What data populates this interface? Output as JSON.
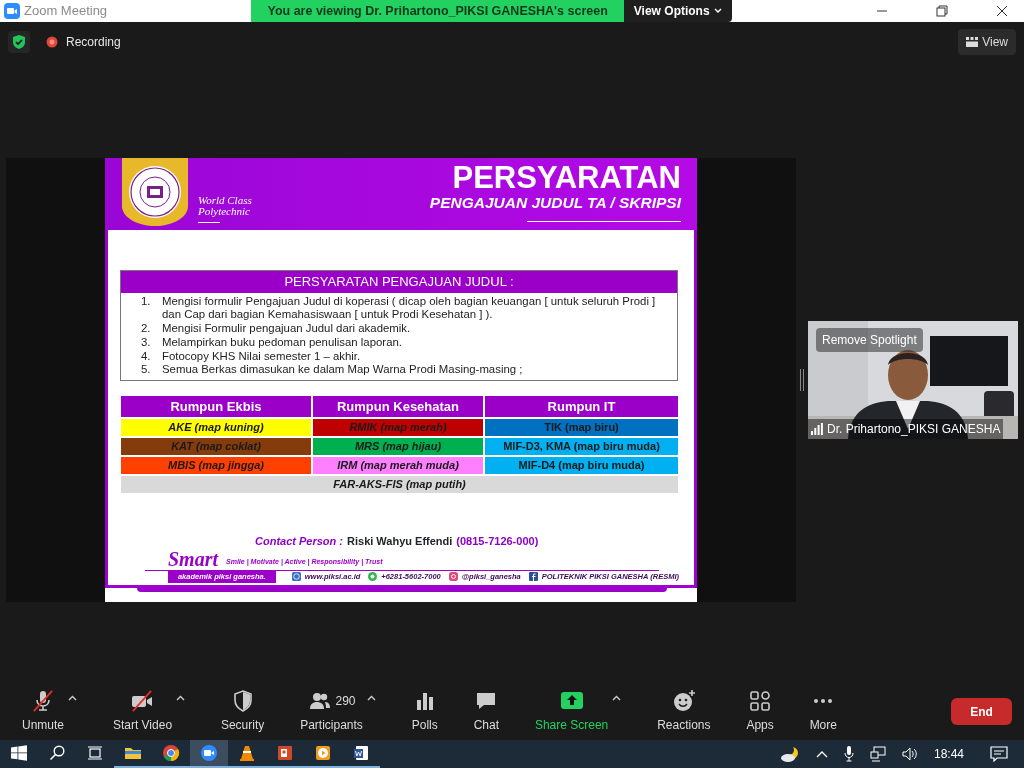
{
  "window": {
    "title": "Zoom Meeting",
    "banner": "You are viewing Dr. Prihartono_PIKSI GANESHA's screen",
    "view_options": "View Options"
  },
  "top_bar": {
    "recording": "Recording",
    "view": "View"
  },
  "slide": {
    "motto": [
      "World Class",
      "Polytechnic"
    ],
    "title": "PERSYARATAN",
    "subtitle": "PENGAJUAN JUDUL TA / SKRIPSI",
    "requirements": {
      "heading": "PERSYARATAN PENGAJUAN JUDUL :",
      "items": [
        {
          "number": "1.",
          "text": "Mengisi formulir Pengajuan Judul di koperasi ( dicap oleh bagian keuangan [ untuk seluruh Prodi ] dan Cap dari bagian Kemahasiswaan [ untuk Prodi Kesehatan ] )."
        },
        {
          "number": "2.",
          "text": "Mengisi Formulir pengajuan Judul dari akademik."
        },
        {
          "number": "3.",
          "text": "Melampirkan buku pedoman penulisan laporan."
        },
        {
          "number": "4.",
          "text": "Fotocopy KHS Nilai semester 1 – akhir."
        },
        {
          "number": "5.",
          "text": "Semua Berkas dimasukan ke dalam Map Warna Prodi Masing-masing ;"
        }
      ]
    },
    "groups_table": {
      "columns": [
        "Rumpun Ekbis",
        "Rumpun Kesehatan",
        "Rumpun IT"
      ],
      "rows": [
        [
          {
            "text": "AKE (map kuning)",
            "color": "#ffff00"
          },
          {
            "text": "RMIK (map merah)",
            "color": "#c00000"
          },
          {
            "text": "TIK (map biru)",
            "color": "#0070c0"
          }
        ],
        [
          {
            "text": "KAT (map coklat)",
            "color": "#843c0c"
          },
          {
            "text": "MRS (map hijau)",
            "color": "#00b050"
          },
          {
            "text": "MIF-D3, KMA (map biru muda)",
            "color": "#00b0f0"
          }
        ],
        [
          {
            "text": "MBIS (map jingga)",
            "color": "#ff4000"
          },
          {
            "text": "IRM (map merah muda)",
            "color": "#ff80ff"
          },
          {
            "text": "MIF-D4 (map biru muda)",
            "color": "#00b0f0"
          }
        ]
      ],
      "footer": {
        "text": "FAR-AKS-FIS (map putih)",
        "color": "#d9d9d9"
      }
    },
    "contact": {
      "label": "Contact Person :",
      "name": "Riski Wahyu Effendi",
      "phone": "(0815-7126-000)"
    },
    "smart": {
      "word": "Smart",
      "values": "Smile | Motivate | Active | Responsibility | Trust"
    },
    "footer": {
      "tag": "akademik piksi ganesha.",
      "links": [
        {
          "kind": "web",
          "text": "www.piksi.ac.id"
        },
        {
          "kind": "whatsapp",
          "text": "+6281-5602-7000"
        },
        {
          "kind": "instagram",
          "text": "@piksi_ganesha"
        },
        {
          "kind": "facebook",
          "text": "POLITEKNIK PIKSI GANESHA (RESMI)"
        }
      ]
    }
  },
  "video_tile": {
    "overlay": "Remove Spotlight",
    "name": "Dr. Prihartono_PIKSI GANESHA"
  },
  "toolbar": {
    "items": [
      {
        "kind": "mic",
        "label": "Unmute",
        "off": true,
        "menu": true
      },
      {
        "kind": "video",
        "label": "Start Video",
        "off": true,
        "menu": true
      },
      {
        "kind": "security",
        "label": "Security",
        "off": false,
        "menu": false
      },
      {
        "kind": "participants",
        "label": "Participants",
        "count": "290",
        "off": false,
        "menu": true
      },
      {
        "kind": "polls",
        "label": "Polls",
        "off": false,
        "menu": false
      },
      {
        "kind": "chat",
        "label": "Chat",
        "off": false,
        "menu": false
      },
      {
        "kind": "share",
        "label": "Share Screen",
        "off": false,
        "menu": true
      },
      {
        "kind": "reactions",
        "label": "Reactions",
        "off": false,
        "menu": false
      },
      {
        "kind": "apps",
        "label": "Apps",
        "off": false,
        "menu": false
      },
      {
        "kind": "more",
        "label": "More",
        "off": false,
        "menu": false
      }
    ],
    "end": "End"
  },
  "taskbar": {
    "apps": [
      {
        "kind": "explorer",
        "active": false
      },
      {
        "kind": "chrome",
        "active": false
      },
      {
        "kind": "zoom",
        "active": true
      },
      {
        "kind": "vlc",
        "active": false
      },
      {
        "kind": "powerpoint",
        "active": false
      },
      {
        "kind": "player",
        "active": false
      },
      {
        "kind": "word",
        "active": false
      }
    ],
    "time": "18:44"
  }
}
